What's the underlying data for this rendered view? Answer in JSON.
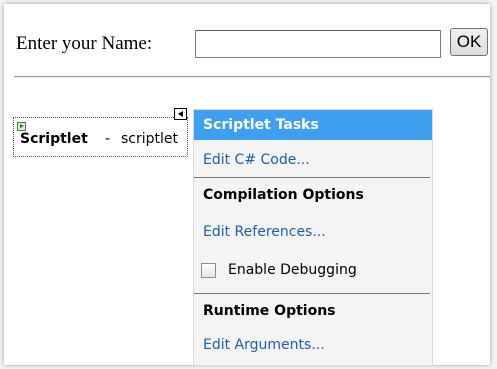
{
  "form": {
    "name_label": "Enter your Name:",
    "name_input_value": "",
    "ok_label": "OK"
  },
  "scriptlet": {
    "title": "Scriptlet",
    "separator": "-",
    "subtitle": "scriptlet"
  },
  "tasks_panel": {
    "header": "Scriptlet Tasks",
    "edit_code": "Edit C# Code...",
    "compilation_section": "Compilation Options",
    "edit_references": "Edit References...",
    "enable_debugging_label": "Enable Debugging",
    "enable_debugging_checked": false,
    "runtime_section": "Runtime Options",
    "edit_arguments": "Edit Arguments..."
  },
  "colors": {
    "header_bg": "#3f9ff0",
    "link": "#1a5fb0"
  },
  "icons": {
    "scriptlet": "play-icon",
    "smart_tag": "smart-tag-arrow-icon"
  }
}
